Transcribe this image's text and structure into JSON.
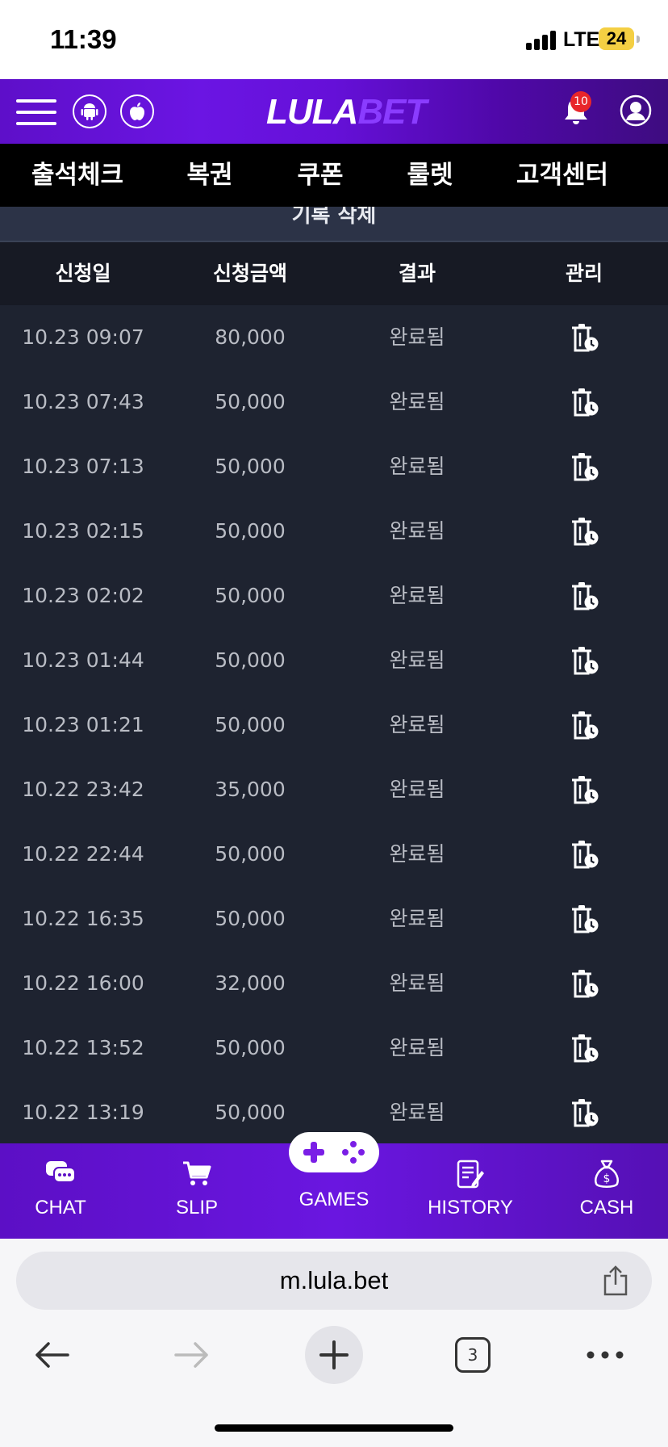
{
  "status_bar": {
    "time": "11:39",
    "network": "LTE",
    "battery": "24"
  },
  "header": {
    "logo_a": "LULA",
    "logo_b": "BET",
    "notification_count": "10"
  },
  "nav": {
    "items": [
      "출석체크",
      "복권",
      "쿠폰",
      "룰렛",
      "고객센터"
    ]
  },
  "delete_label": "기록 삭제",
  "table": {
    "headers": [
      "신청일",
      "신청금액",
      "결과",
      "관리"
    ],
    "rows": [
      {
        "date": "10.23 09:07",
        "amount": "80,000",
        "result": "완료됨"
      },
      {
        "date": "10.23 07:43",
        "amount": "50,000",
        "result": "완료됨"
      },
      {
        "date": "10.23 07:13",
        "amount": "50,000",
        "result": "완료됨"
      },
      {
        "date": "10.23 02:15",
        "amount": "50,000",
        "result": "완료됨"
      },
      {
        "date": "10.23 02:02",
        "amount": "50,000",
        "result": "완료됨"
      },
      {
        "date": "10.23 01:44",
        "amount": "50,000",
        "result": "완료됨"
      },
      {
        "date": "10.23 01:21",
        "amount": "50,000",
        "result": "완료됨"
      },
      {
        "date": "10.22 23:42",
        "amount": "35,000",
        "result": "완료됨"
      },
      {
        "date": "10.22 22:44",
        "amount": "50,000",
        "result": "완료됨"
      },
      {
        "date": "10.22 16:35",
        "amount": "50,000",
        "result": "완료됨"
      },
      {
        "date": "10.22 16:00",
        "amount": "32,000",
        "result": "완료됨"
      },
      {
        "date": "10.22 13:52",
        "amount": "50,000",
        "result": "완료됨"
      },
      {
        "date": "10.22 13:19",
        "amount": "50,000",
        "result": "완료됨"
      }
    ]
  },
  "bottom_nav": {
    "chat": "CHAT",
    "slip": "SLIP",
    "games": "GAMES",
    "history": "HISTORY",
    "cash": "CASH"
  },
  "browser": {
    "url": "m.lula.bet",
    "tab_count": "3"
  },
  "colors": {
    "brand_purple": "#6a16e0",
    "content_bg": "#1e2330",
    "badge_red": "#e8262a"
  }
}
